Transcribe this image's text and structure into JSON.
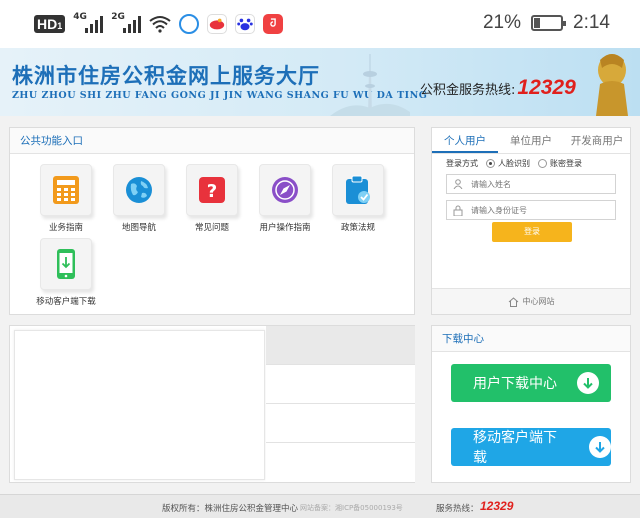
{
  "status_bar": {
    "hd": "HD",
    "hd_sub": "1",
    "sim1_label": "4G",
    "sim2_label": "2G",
    "battery_percent": "21%",
    "battery_level": 0.21,
    "time": "2:14"
  },
  "banner": {
    "title": "株洲市住房公积金网上服务大厅",
    "subtitle": "ZHU ZHOU SHI ZHU FANG GONG JI JIN WANG SHANG FU WU DA TING",
    "hotline_label": "公积金服务热线:",
    "hotline_number": "12329"
  },
  "public_functions": {
    "title": "公共功能入口",
    "items": [
      {
        "label": "业务指南",
        "icon": "calculator-icon",
        "color": "#f29a1c"
      },
      {
        "label": "地图导航",
        "icon": "globe-icon",
        "color": "#1a8fd6"
      },
      {
        "label": "常见问题",
        "icon": "question-icon",
        "color": "#e8323c"
      },
      {
        "label": "用户操作指南",
        "icon": "compass-icon",
        "color": "#8a4fc8"
      },
      {
        "label": "政策法规",
        "icon": "clipboard-check-icon",
        "color": "#1b8fd6"
      },
      {
        "label": "移动客户端下载",
        "icon": "mobile-download-icon",
        "color": "#2fbf5a"
      }
    ]
  },
  "login": {
    "tabs": [
      "个人用户",
      "单位用户",
      "开发商用户"
    ],
    "active_tab": 0,
    "method_label": "登录方式",
    "method_options": [
      "人脸识别",
      "账密登录"
    ],
    "selected_method": 0,
    "name_placeholder": "请输入姓名",
    "id_placeholder": "请输入身份证号",
    "login_button": "登录",
    "center_site": "中心网站"
  },
  "download_center": {
    "title": "下载中心",
    "user_download": "用户下载中心",
    "mobile_download": "移动客户端下载",
    "user_download_color": "#22c06a",
    "mobile_download_color": "#1fa6e6"
  },
  "footer": {
    "copyright": "版权所有：株洲住房公积金管理中心",
    "icp": "网站备案：湘ICP备05000193号",
    "hotline_label": "服务热线：",
    "hotline_number": "12329"
  }
}
